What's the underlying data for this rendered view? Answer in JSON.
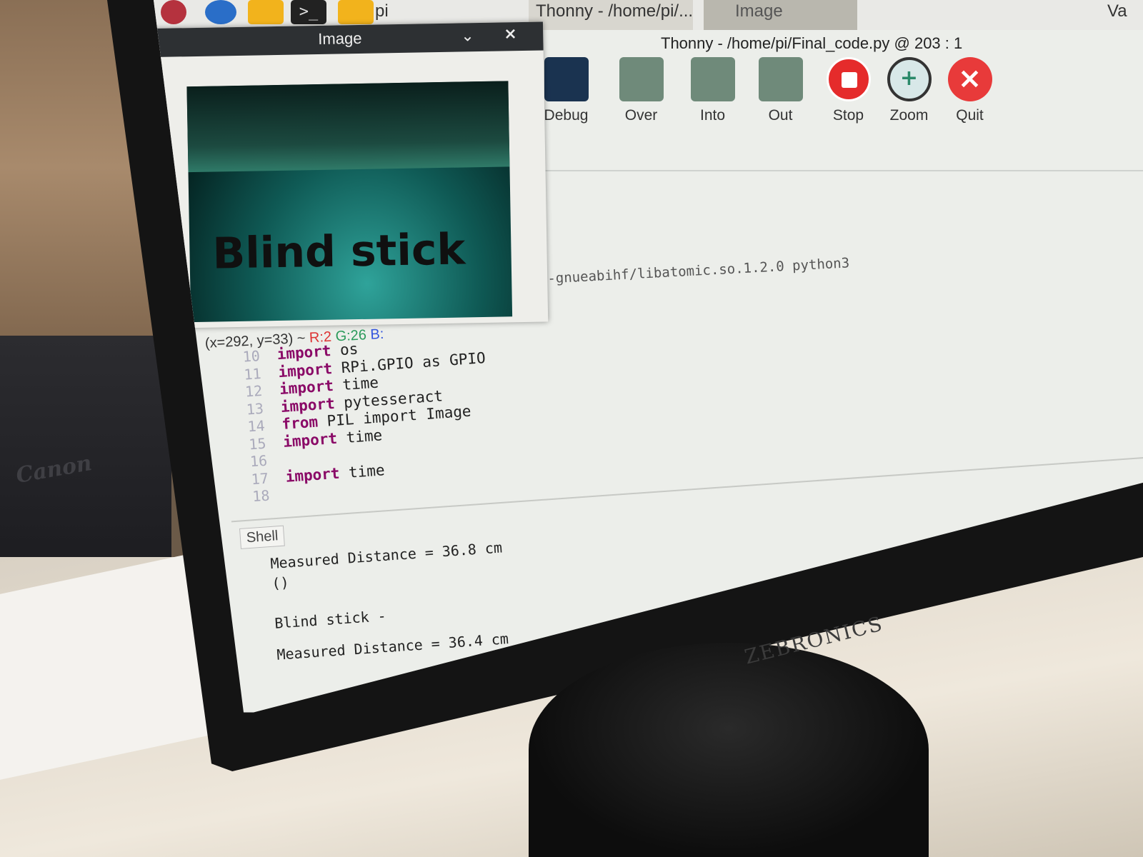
{
  "taskbar": {
    "pi_label": "pi",
    "thonny_task": "Thonny - /home/pi/...",
    "image_task": "Image",
    "right_clip": "Va"
  },
  "thonny": {
    "title": "Thonny - /home/pi/Final_code.py @ 203 : 1",
    "toolbar": [
      "Debug",
      "Over",
      "Into",
      "Out",
      "Stop",
      "Zoom",
      "Quit"
    ],
    "lib_line": "x-gnueabihf/libatomic.so.1.2.0 python3"
  },
  "editor": {
    "line_numbers": [
      "10",
      "11",
      "12",
      "13",
      "14",
      "15",
      "16",
      "17",
      "18"
    ],
    "lines": [
      {
        "kw": "import",
        "rest": " os"
      },
      {
        "kw": "import",
        "rest": " RPi.GPIO as GPIO"
      },
      {
        "kw": "import",
        "rest": " time"
      },
      {
        "kw": "import",
        "rest": " pytesseract"
      },
      {
        "kw": "from",
        "rest": " PIL import Image"
      },
      {
        "kw": "import",
        "rest": " time"
      },
      {
        "kw": "",
        "rest": ""
      },
      {
        "kw": "import",
        "rest": " time"
      },
      {
        "kw": "",
        "rest": ""
      }
    ]
  },
  "shell": {
    "tab": "Shell",
    "lines": [
      "Measured Distance = 36.8 cm",
      "()",
      "",
      "Blind stick -",
      "",
      "Measured Distance = 36.4 cm"
    ]
  },
  "image_window": {
    "title": "Image",
    "chevron": "⌄",
    "close": "×",
    "camera_text": "Blind stick",
    "status_prefix": "(x=292, y=33) ~",
    "status_r": "R:2",
    "status_g": "G:26",
    "status_b": "B:"
  },
  "scene": {
    "monitor_brand": "ZEBRONICS",
    "printer_brand": "Canon"
  }
}
